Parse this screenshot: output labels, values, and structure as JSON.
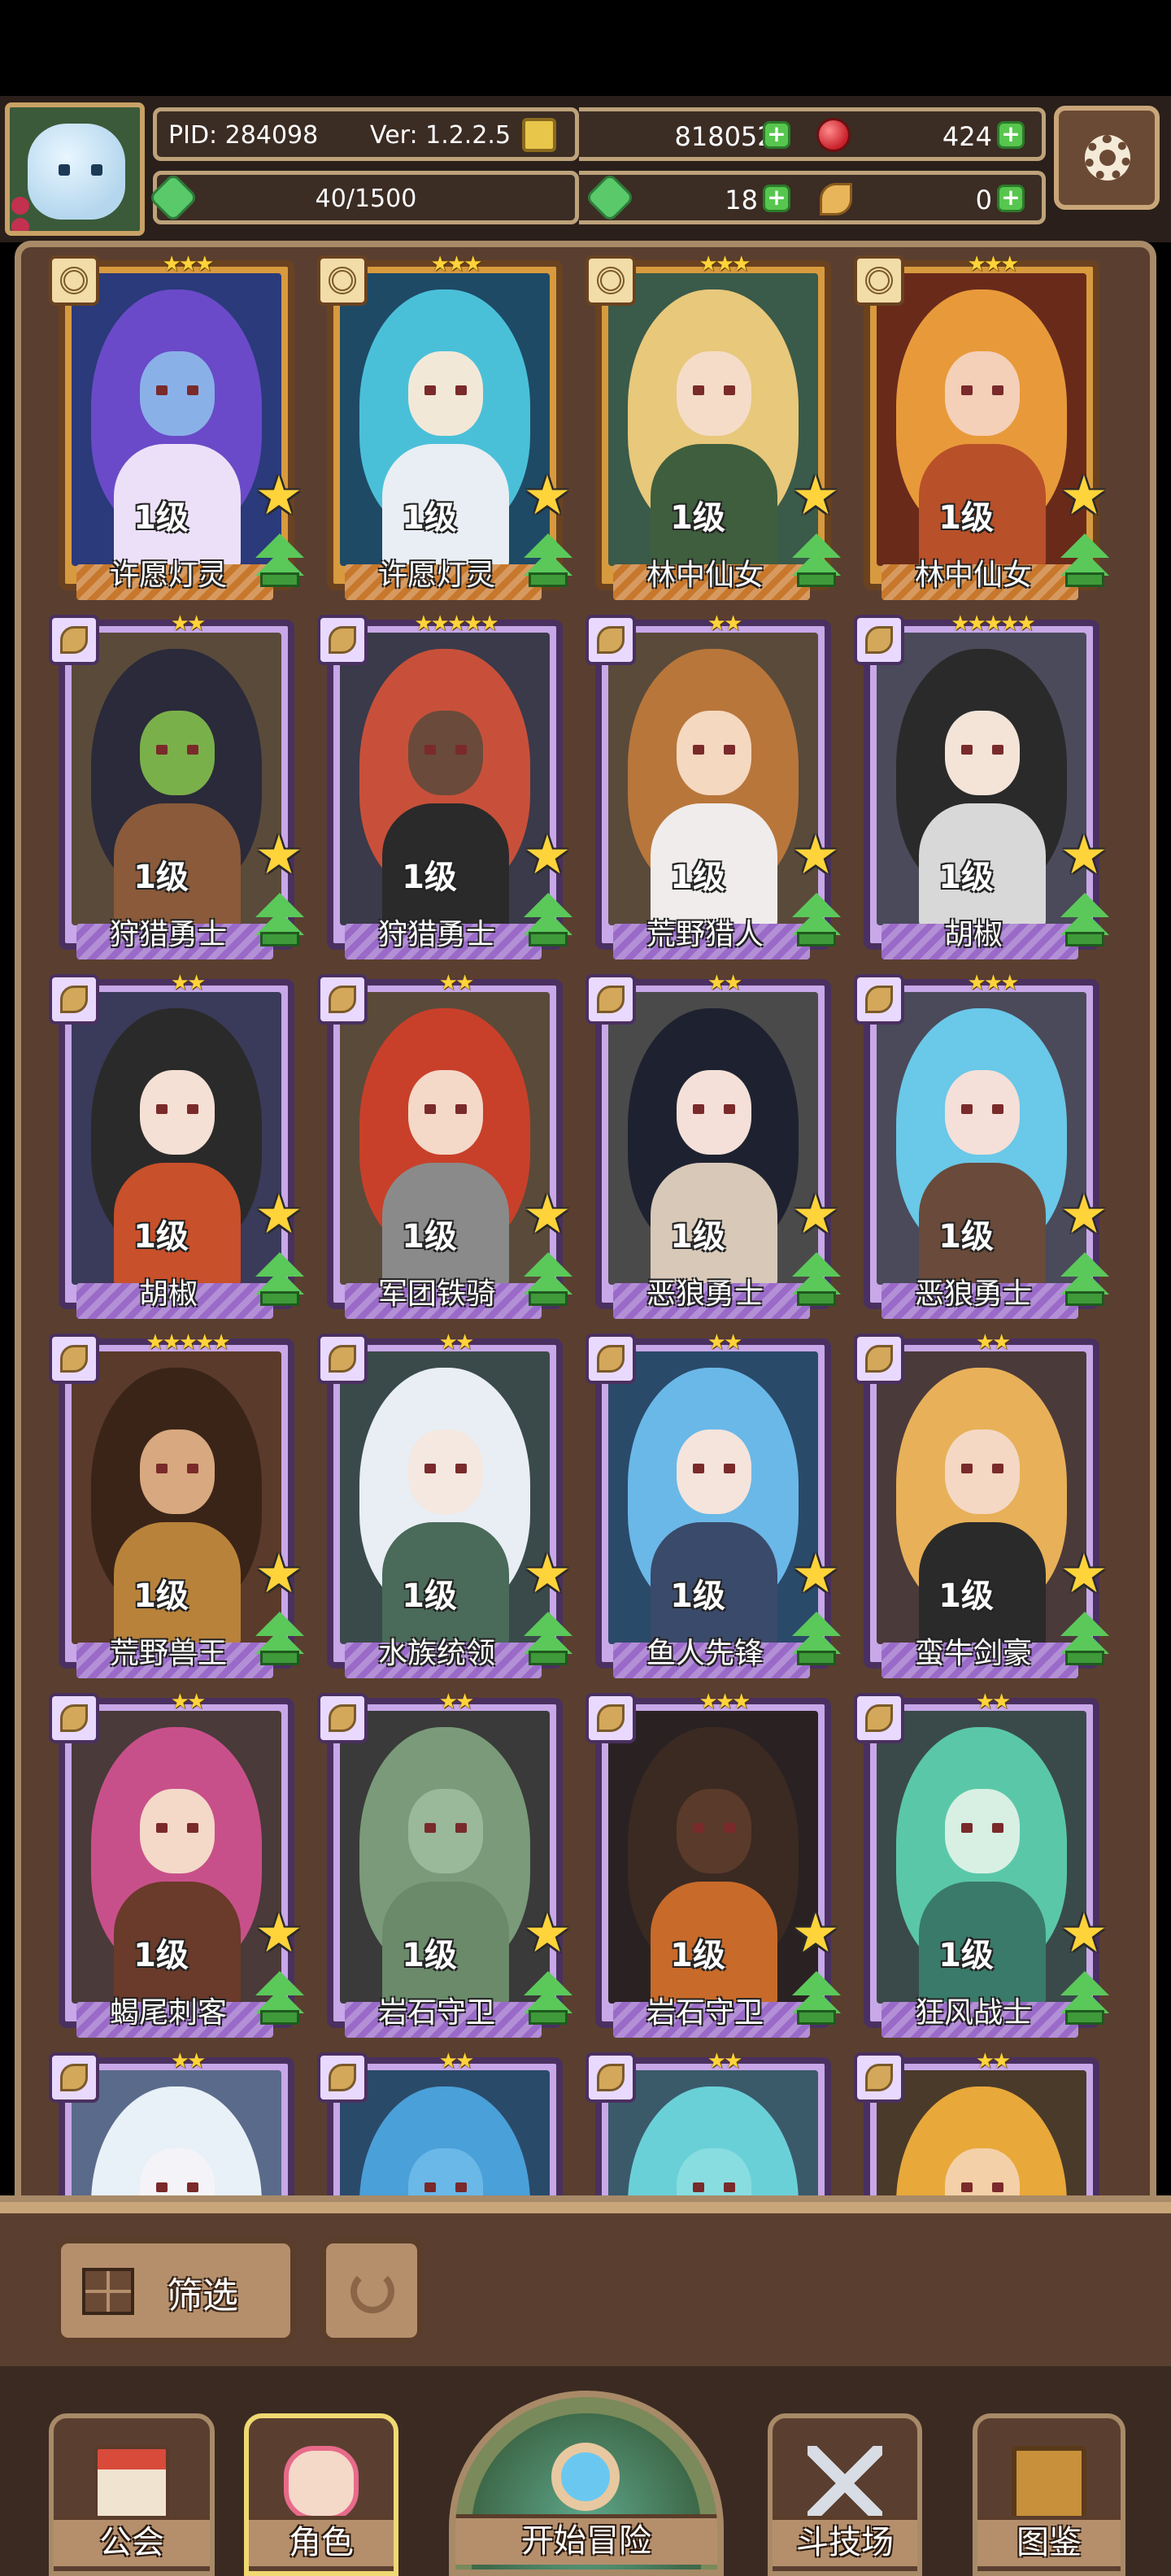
{
  "header": {
    "pid": "PID: 284098",
    "version": "Ver: 1.2.2.5",
    "gold": "8180524",
    "gems": "424",
    "progress": "40/1500",
    "clover_count": "18",
    "feather_count": "0",
    "icons": {
      "avatar": "ghost-avatar-icon",
      "gold": "gold-coin-icon",
      "gem": "red-gem-icon",
      "clover": "clover-icon",
      "feather": "feather-icon",
      "add": "plus-icon",
      "settings": "gear-icon"
    }
  },
  "cards": [
    {
      "name": "许愿灯灵",
      "level": "1级",
      "stars": "★★★",
      "frame": "gold",
      "palette": [
        "#2a3a7a",
        "#6a4ac8",
        "#8ab0e8",
        "#ece0f8"
      ]
    },
    {
      "name": "许愿灯灵",
      "level": "1级",
      "stars": "★★★",
      "frame": "gold",
      "palette": [
        "#1e4a66",
        "#4ac0d8",
        "#f2e8d8",
        "#e8eef4"
      ]
    },
    {
      "name": "林中仙女",
      "level": "1级",
      "stars": "★★★",
      "frame": "gold",
      "palette": [
        "#3a5a4a",
        "#e8c87a",
        "#f4dcc8",
        "#3e5e3e"
      ]
    },
    {
      "name": "林中仙女",
      "level": "1级",
      "stars": "★★★",
      "frame": "gold",
      "palette": [
        "#6a2a1a",
        "#e89a3a",
        "#f4d0b8",
        "#b8502a"
      ]
    },
    {
      "name": "狩猎勇士",
      "level": "1级",
      "stars": "★★",
      "frame": "purple",
      "palette": [
        "#5a4a3a",
        "#2a2a3a",
        "#7ab04a",
        "#8a5a3a"
      ]
    },
    {
      "name": "狩猎勇士",
      "level": "1级",
      "stars": "★★★★★",
      "frame": "purple",
      "palette": [
        "#3a3a4a",
        "#c8503a",
        "#6a4a3a",
        "#2a2a2a"
      ]
    },
    {
      "name": "荒野猎人",
      "level": "1级",
      "stars": "★★",
      "frame": "purple",
      "palette": [
        "#5a4a3a",
        "#b8763a",
        "#f4d8c0",
        "#f0ecec"
      ]
    },
    {
      "name": "胡椒",
      "level": "1级",
      "stars": "★★★★★",
      "frame": "purple",
      "palette": [
        "#4a4a5a",
        "#2a2a2a",
        "#f4e4d8",
        "#d8d8d8"
      ]
    },
    {
      "name": "胡椒",
      "level": "1级",
      "stars": "★★",
      "frame": "purple",
      "palette": [
        "#3a3a5a",
        "#2a2a2a",
        "#f4e0d4",
        "#c8502a"
      ]
    },
    {
      "name": "军团铁骑",
      "level": "1级",
      "stars": "★★",
      "frame": "purple",
      "palette": [
        "#5a4a3a",
        "#c8402a",
        "#f4d8c8",
        "#8a8a8a"
      ]
    },
    {
      "name": "恶狼勇士",
      "level": "1级",
      "stars": "★★",
      "frame": "purple",
      "palette": [
        "#4a4a4a",
        "#1e2230",
        "#f4e0d8",
        "#d8c8b8"
      ]
    },
    {
      "name": "恶狼勇士",
      "level": "1级",
      "stars": "★★★",
      "frame": "purple",
      "palette": [
        "#4a4a5a",
        "#6ac8e8",
        "#f4e0d8",
        "#6a4a3a"
      ]
    },
    {
      "name": "荒野兽王",
      "level": "1级",
      "stars": "★★★★★",
      "frame": "purple",
      "palette": [
        "#5a3a2a",
        "#3a2418",
        "#d8a880",
        "#b8823a"
      ]
    },
    {
      "name": "水族统领",
      "level": "1级",
      "stars": "★★",
      "frame": "purple",
      "palette": [
        "#3a4a4a",
        "#e8eef4",
        "#f4e8e0",
        "#4a6a5a"
      ]
    },
    {
      "name": "鱼人先锋",
      "level": "1级",
      "stars": "★★",
      "frame": "purple",
      "palette": [
        "#2a4a6a",
        "#6ab8e8",
        "#f4e4dc",
        "#3a4a6a"
      ]
    },
    {
      "name": "蛮牛剑豪",
      "level": "1级",
      "stars": "★★",
      "frame": "purple",
      "palette": [
        "#4a3a3a",
        "#e8b058",
        "#f4d8c4",
        "#2a2a2a"
      ]
    },
    {
      "name": "蝎尾刺客",
      "level": "1级",
      "stars": "★★",
      "frame": "purple",
      "palette": [
        "#4a3a3a",
        "#c8508a",
        "#f4d8c8",
        "#6a3a2a"
      ]
    },
    {
      "name": "岩石守卫",
      "level": "1级",
      "stars": "★★",
      "frame": "purple",
      "palette": [
        "#3a3a3a",
        "#7a9a7a",
        "#9ab89a",
        "#6a8a6a"
      ]
    },
    {
      "name": "岩石守卫",
      "level": "1级",
      "stars": "★★★",
      "frame": "purple",
      "palette": [
        "#2a2222",
        "#3a2a22",
        "#5a3a2a",
        "#c86a2a"
      ]
    },
    {
      "name": "狂风战士",
      "level": "1级",
      "stars": "★★",
      "frame": "purple",
      "palette": [
        "#3a4a4a",
        "#5ac8a8",
        "#d8f0e4",
        "#3a7a6a"
      ]
    },
    {
      "name": "",
      "level": "",
      "stars": "★★",
      "frame": "purple",
      "palette": [
        "#5a6a8a",
        "#e8f0f8",
        "#f4f4f8",
        "#b8c8e0"
      ]
    },
    {
      "name": "",
      "level": "",
      "stars": "★★",
      "frame": "purple",
      "palette": [
        "#2a4a6a",
        "#4aa0d8",
        "#6ab8e8",
        "#3a7ab8"
      ]
    },
    {
      "name": "",
      "level": "",
      "stars": "★★",
      "frame": "purple",
      "palette": [
        "#3a5a6a",
        "#6ad0d8",
        "#88dde0",
        "#4aa0a8"
      ]
    },
    {
      "name": "",
      "level": "",
      "stars": "★★",
      "frame": "purple",
      "palette": [
        "#4a3a2a",
        "#e8a83a",
        "#f4d0a8",
        "#c8802a"
      ]
    }
  ],
  "controls": {
    "filter_label": "筛选",
    "filter_icon": "grid-filter-icon",
    "refresh_icon": "refresh-icon"
  },
  "nav": {
    "guild": "公会",
    "character": "角色",
    "adventure": "开始冒险",
    "arena": "斗技场",
    "codex": "图鉴",
    "active": "character",
    "icons": {
      "guild": "guild-building-icon",
      "character": "character-face-icon",
      "adventure": "magnifier-map-icon",
      "arena": "crossed-swords-icon",
      "codex": "book-icon"
    }
  },
  "colors": {
    "gold_frame": "#d89a3e",
    "purple_frame": "#c8a8e8",
    "plus_green": "#57c64e",
    "star_yellow": "#ffd33a"
  }
}
